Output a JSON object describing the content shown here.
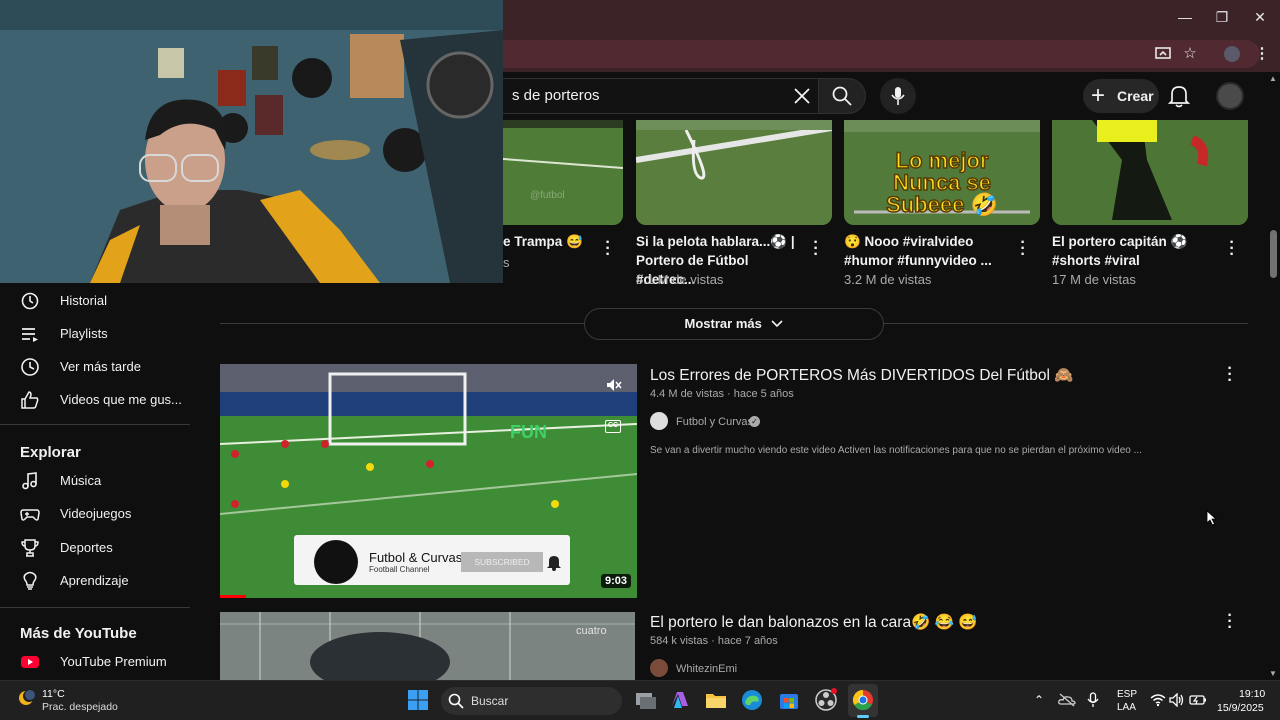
{
  "browser": {
    "window_controls": [
      "—",
      "❐",
      "✕"
    ]
  },
  "youtube": {
    "search_value": "s de porteros",
    "create_label": "Crear"
  },
  "sidebar": {
    "items_top": [
      {
        "label": "Historial",
        "icon": "history-icon"
      },
      {
        "label": "Playlists",
        "icon": "playlist-icon"
      },
      {
        "label": "Ver más tarde",
        "icon": "clock-icon"
      },
      {
        "label": "Videos que me gus...",
        "icon": "thumbs-up-icon"
      }
    ],
    "explore_heading": "Explorar",
    "explore_items": [
      {
        "label": "Música",
        "icon": "music-note-icon"
      },
      {
        "label": "Videojuegos",
        "icon": "gamepad-icon"
      },
      {
        "label": "Deportes",
        "icon": "trophy-icon"
      },
      {
        "label": "Aprendizaje",
        "icon": "lightbulb-icon"
      }
    ],
    "more_heading": "Más de YouTube",
    "more_items": [
      {
        "label": "YouTube Premium",
        "icon": "youtube-premium-icon"
      }
    ]
  },
  "shorts": [
    {
      "title": "e Trampa 😅",
      "views": "s"
    },
    {
      "title": "Si la pelota hablara...⚽ | Portero de Fútbol #detrec...",
      "views": "5.1 M de vistas"
    },
    {
      "title": "😯 Nooo #viralvideo #humor #funnyvideo ...",
      "views": "3.2 M de vistas",
      "overlay": "Lo mejor Nunca se Subeee 🤣"
    },
    {
      "title": "El portero capitán ⚽ #shorts #viral",
      "views": "17 M de vistas"
    }
  ],
  "show_more": "Mostrar más",
  "videos": [
    {
      "title": "Los Errores de PORTEROS Más DIVERTIDOS Del Fútbol 🙈",
      "meta": "4.4 M de vistas · hace 5 años",
      "channel": "Futbol y Curvas",
      "verified": true,
      "description": "Se van a divertir mucho viendo este video Activen las notificaciones para que no se pierdan el próximo video ...",
      "duration": "9:03",
      "thumb_sign": "FUN",
      "overlay_channel": "Futbol & Curvas",
      "overlay_sub": "Football Channel",
      "overlay_btn": "SUBSCRIBED"
    },
    {
      "title": "El portero le dan balonazos en la cara🤣 😂 😅",
      "meta": "584 k vistas · hace 7 años",
      "channel": "WhitezinEmi"
    }
  ],
  "taskbar": {
    "weather_temp": "11°C",
    "weather_desc": "Prac. despejado",
    "search_label": "Buscar",
    "lang_top": "ESP",
    "lang_bottom": "LAA",
    "time": "19:10",
    "date": "15/9/2025"
  }
}
